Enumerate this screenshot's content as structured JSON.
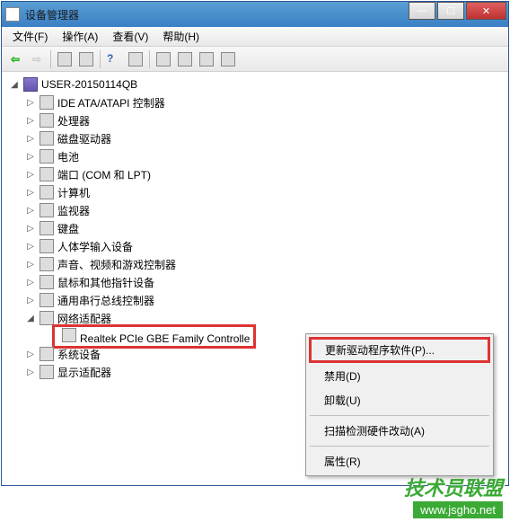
{
  "window": {
    "title": "设备管理器"
  },
  "menu": {
    "file": "文件(F)",
    "action": "操作(A)",
    "view": "查看(V)",
    "help": "帮助(H)"
  },
  "tree": {
    "root": "USER-20150114QB",
    "nodes": [
      {
        "label": "IDE ATA/ATAPI 控制器",
        "expanded": false
      },
      {
        "label": "处理器",
        "expanded": false
      },
      {
        "label": "磁盘驱动器",
        "expanded": false
      },
      {
        "label": "电池",
        "expanded": false
      },
      {
        "label": "端口 (COM 和 LPT)",
        "expanded": false
      },
      {
        "label": "计算机",
        "expanded": false
      },
      {
        "label": "监视器",
        "expanded": false
      },
      {
        "label": "键盘",
        "expanded": false
      },
      {
        "label": "人体学输入设备",
        "expanded": false
      },
      {
        "label": "声音、视频和游戏控制器",
        "expanded": false
      },
      {
        "label": "鼠标和其他指针设备",
        "expanded": false
      },
      {
        "label": "通用串行总线控制器",
        "expanded": false
      },
      {
        "label": "网络适配器",
        "expanded": true,
        "children": [
          {
            "label": "Realtek PCIe GBE Family Controlle",
            "selected": true
          }
        ]
      },
      {
        "label": "系统设备",
        "expanded": false
      },
      {
        "label": "显示适配器",
        "expanded": false
      }
    ]
  },
  "context_menu": {
    "update_driver": "更新驱动程序软件(P)...",
    "disable": "禁用(D)",
    "uninstall": "卸载(U)",
    "scan": "扫描检测硬件改动(A)",
    "properties": "属性(R)"
  },
  "watermark": {
    "text": "技术员联盟",
    "url": "www.jsgho.net"
  },
  "win_controls": {
    "minimize": "—",
    "maximize": "☐",
    "close": "✕"
  }
}
